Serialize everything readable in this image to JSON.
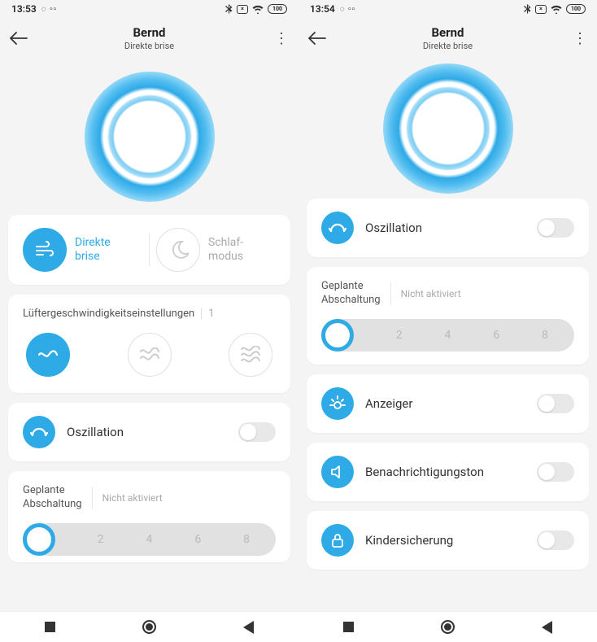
{
  "left": {
    "statusbar": {
      "time": "13:53",
      "battery": "100"
    },
    "header": {
      "title": "Bernd",
      "subtitle": "Direkte brise"
    },
    "modes": {
      "direct": {
        "label": "Direkte\nbrise"
      },
      "sleep": {
        "label": "Schlaf-\nmodus"
      }
    },
    "speed": {
      "title": "Lüftergeschwindigkeitseinstellungen",
      "value": "1"
    },
    "oscillation": {
      "label": "Oszillation"
    },
    "schedule": {
      "title": "Geplante\nAbschaltung",
      "status": "Nicht aktiviert",
      "ticks": [
        "",
        "2",
        "4",
        "6",
        "8"
      ]
    }
  },
  "right": {
    "statusbar": {
      "time": "13:54",
      "battery": "100"
    },
    "header": {
      "title": "Bernd",
      "subtitle": "Direkte brise"
    },
    "oscillation": {
      "label": "Oszillation"
    },
    "schedule": {
      "title": "Geplante\nAbschaltung",
      "status": "Nicht aktiviert",
      "ticks": [
        "",
        "2",
        "4",
        "6",
        "8"
      ]
    },
    "display": {
      "label": "Anzeiger"
    },
    "sound": {
      "label": "Benachrichtigungston"
    },
    "childlock": {
      "label": "Kindersicherung"
    }
  }
}
